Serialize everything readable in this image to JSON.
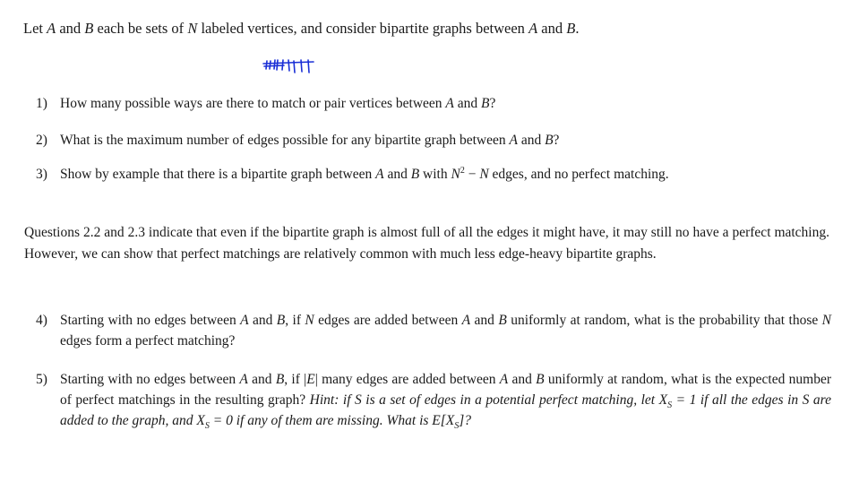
{
  "intro": {
    "p1": "Let ",
    "A": "A",
    "p2": " and ",
    "B": "B",
    "p3": " each be sets of ",
    "N": "N",
    "p4": " labeled vertices, and consider bipartite graphs between ",
    "p5": " and ",
    "p6": "."
  },
  "annotation": {
    "icon": "handwritten-tally-marks",
    "color": "#1a2fd6"
  },
  "questions_a": [
    {
      "num": "1)",
      "t1": "How many possible ways are there to match or pair vertices between ",
      "A": "A",
      "t2": " and ",
      "B": "B",
      "t3": "?"
    },
    {
      "num": "2)",
      "t1": "What is the maximum number of edges possible for any bipartite graph between ",
      "A": "A",
      "t2": " and ",
      "B": "B",
      "t3": "?"
    },
    {
      "num": "3)",
      "t1": "Show by example that there is a bipartite graph between ",
      "A": "A",
      "t2": " and ",
      "B": "B",
      "t3": " with ",
      "N": "N",
      "sup": "2",
      "minus": " − ",
      "N2": "N",
      "t4": " edges, and no perfect matching."
    }
  ],
  "paragraph": "Questions 2.2 and 2.3 indicate that even if the bipartite graph is almost full of all the edges it might have, it may still no have a perfect matching. However, we can show that perfect matchings are relatively common with much less edge-heavy bipartite graphs.",
  "questions_b": [
    {
      "num": "4)",
      "t1": "Starting with no edges between ",
      "A": "A",
      "t2": " and ",
      "B": "B",
      "t3": ", if ",
      "N": "N",
      "t4": " edges are added between ",
      "t5": " and ",
      "t6": " uniformly at random, what is the probability that those ",
      "t7": " edges form a perfect matching?"
    },
    {
      "num": "5)",
      "t1": "Starting with no edges between ",
      "A": "A",
      "t2": " and ",
      "B": "B",
      "t3": ", if |",
      "E": "E",
      "t4": "| many edges are added between ",
      "t5": " and ",
      "t6": " uniformly at random, what is the expected number of perfect matchings in the resulting graph? ",
      "hint_label": "Hint:",
      "h1": " if S is a set of edges in a potential perfect matching, let X",
      "sub": "S",
      "h2": " = 1 if all the edges in S are added to the graph, and X",
      "h3": " = 0 if any of them are missing. What is E[X",
      "h4": "]?"
    }
  ]
}
